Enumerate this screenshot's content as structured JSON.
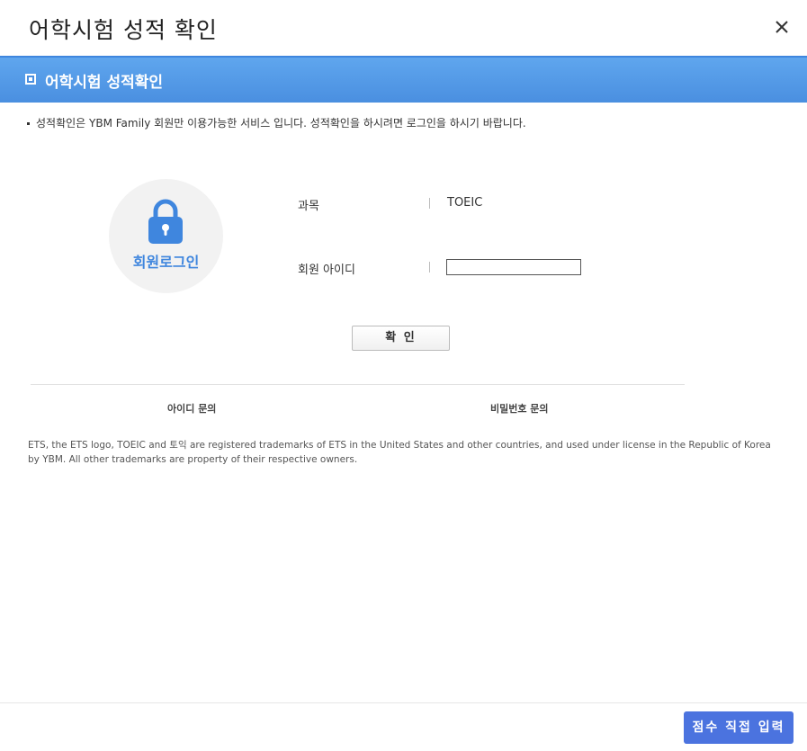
{
  "dialog": {
    "title": "어학시험 성적 확인",
    "close_icon": "close-icon"
  },
  "section": {
    "title": "어학시험 성적확인"
  },
  "notice": "성적확인은 YBM Family 회원만 이용가능한 서비스 입니다. 성적확인을 하시려면 로그인을 하시기 바랍니다.",
  "login_badge": {
    "icon": "lock-icon",
    "label": "회원로그인"
  },
  "form": {
    "subject_label": "과목",
    "subject_value": "TOEIC",
    "id_label": "회원 아이디",
    "id_value": "",
    "confirm_label": "확 인"
  },
  "links": {
    "find_id": "아이디 문의",
    "find_password": "비밀번호 문의"
  },
  "disclaimer": "ETS, the ETS logo, TOEIC and 토익 are registered trademarks of ETS in the United States and other countries, and used under license in the Republic of Korea by YBM. All other trademarks are property of their respective owners.",
  "footer": {
    "score_button": "점수 직접 입력"
  },
  "colors": {
    "section_bar": "#4a8fe0",
    "accent_text": "#3f86de",
    "primary_button": "#4b73df"
  }
}
